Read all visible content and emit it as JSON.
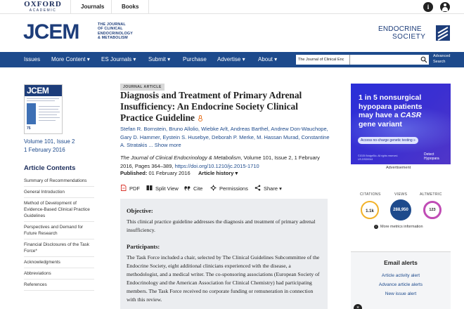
{
  "topbar": {
    "logo_line1": "OXFORD",
    "logo_line2": "ACADEMIC",
    "journals": "Journals",
    "books": "Books",
    "info_icon": "info-icon",
    "user_icon": "user-icon"
  },
  "header": {
    "journal_abbr": "JCEM",
    "journal_full_1": "THE JOURNAL",
    "journal_full_2": "OF CLINICAL",
    "journal_full_3": "ENDOCRINOLOGY",
    "journal_full_4": "& METABOLISM",
    "society_line1": "ENDOCRINE",
    "society_line2": "SOCIETY"
  },
  "nav": {
    "items": [
      "Issues",
      "More Content ▾",
      "ES Journals ▾",
      "Submit ▾",
      "Purchase",
      "Advertise ▾",
      "About ▾"
    ],
    "search_scope": "The Journal of Clinical Enc",
    "search_placeholder": "",
    "advanced_1": "Advanced",
    "advanced_2": "Search"
  },
  "sidebar": {
    "cover_title": "JCEM",
    "cover_number": "75",
    "volume": "Volume 101, Issue 2",
    "date": "1 February 2016",
    "contents_title": "Article Contents",
    "contents": [
      "Summary of Recommendations",
      "General Introduction",
      "Method of Development of Evidence-Based Clinical Practice Guidelines",
      "Perspectives and Demand for Future Research",
      "Financial Disclosures of the Task Force*",
      "Acknowledgments",
      "Abbreviations",
      "References"
    ]
  },
  "article": {
    "type_badge": "JOURNAL ARTICLE",
    "title": "Diagnosis and Treatment of Primary Adrenal Insufficiency: An Endocrine Society Clinical Practice Guideline",
    "authors": "Stefan R. Bornstein, Bruno Allolio, Wiebke Arlt, Andreas Barthel, Andrew Don-Wauchope, Gary D. Hammer, Eystein S. Husebye, Deborah P. Merke, M. Hassan Murad, Constantine A. Stratakis ...",
    "show_more": "Show more",
    "citation_journal": "The Journal of Clinical Endocrinology & Metabolism",
    "citation_rest": ", Volume 101, Issue 2, 1 February 2016, Pages 364–389, ",
    "doi": "https://doi.org/10.1210/jc.2015-1710",
    "published_label": "Published:",
    "published_date": "01 February 2016",
    "history": "Article history ▾",
    "tools": {
      "pdf": "PDF",
      "split": "Split View",
      "cite": "Cite",
      "permissions": "Permissions",
      "share": "Share ▾"
    },
    "abstract": {
      "objective_head": "Objective:",
      "objective_text": "This clinical practice guideline addresses the diagnosis and treatment of primary adrenal insufficiency.",
      "participants_head": "Participants:",
      "participants_text": "The Task Force included a chair, selected by The Clinical Guidelines Subcommittee of the Endocrine Society, eight additional clinicians experienced with the disease, a methodologist, and a medical writer. The co-sponsoring associations (European Society of Endocrinology and the American Association for Clinical Chemistry) had participating members. The Task Force received no corporate funding or remuneration in connection with this review."
    }
  },
  "ad": {
    "line1": "1 in 5 nonsurgical",
    "line2": "hypopara patients",
    "line3_pre": "may have a ",
    "line3_em": "CASR",
    "line4": "gene variant",
    "button": "Access no-charge genetic testing »",
    "fine1": "©2025 BridgeBio. All rights reserved.",
    "fine2": "US-DSD0044",
    "brand1": "Detect",
    "brand2": "Hypopara",
    "label": "Advertisement"
  },
  "metrics": {
    "citations_label": "CITATIONS",
    "citations": "1.1k",
    "views_label": "VIEWS",
    "views": "288,950",
    "altmetric_label": "ALTMETRIC",
    "altmetric": "123",
    "more": "More metrics information"
  },
  "alerts": {
    "title": "Email alerts",
    "links": [
      "Article activity alert",
      "Advance article alerts",
      "New issue alert"
    ]
  },
  "colors": {
    "brand_navy": "#1d3d7a",
    "nav_blue": "#1d4a8c",
    "open_access_orange": "#e87b2e",
    "abstract_bg": "#ebedf0"
  }
}
